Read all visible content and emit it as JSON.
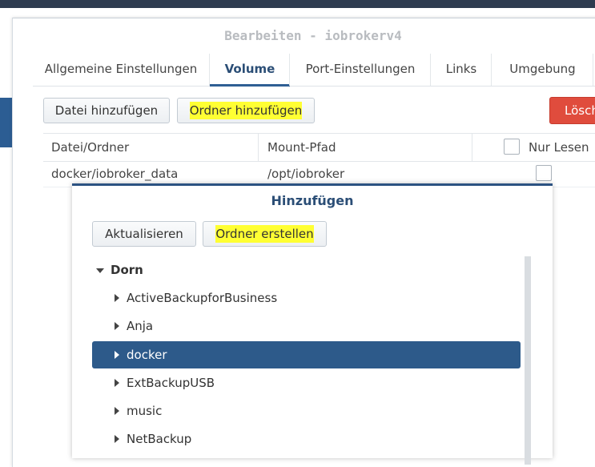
{
  "window": {
    "title": "Bearbeiten - iobrokerv4"
  },
  "tabs": [
    {
      "label": "Allgemeine Einstellungen"
    },
    {
      "label": "Volume"
    },
    {
      "label": "Port-Einstellungen"
    },
    {
      "label": "Links"
    },
    {
      "label": "Umgebung"
    }
  ],
  "toolbar": {
    "add_file_label": "Datei hinzufügen",
    "add_folder_label": "Ordner hinzufügen",
    "delete_label": "Lösch"
  },
  "table": {
    "columns": [
      "Datei/Ordner",
      "Mount-Pfad",
      "Nur Lesen"
    ],
    "rows": [
      {
        "folder": "docker/iobroker_data",
        "mount": "/opt/iobroker",
        "readonly": false
      }
    ]
  },
  "dialog": {
    "title": "Hinzufügen",
    "refresh_label": "Aktualisieren",
    "create_folder_label": "Ordner erstellen",
    "tree": {
      "root": "Dorn",
      "items": [
        "ActiveBackupforBusiness",
        "Anja",
        "docker",
        "ExtBackupUSB",
        "music",
        "NetBackup"
      ],
      "selected": "docker"
    }
  },
  "colors": {
    "highlight": "#ffff33",
    "accent": "#2c5282",
    "selected_row": "#2d5a8a",
    "danger": "#e04c3d"
  }
}
